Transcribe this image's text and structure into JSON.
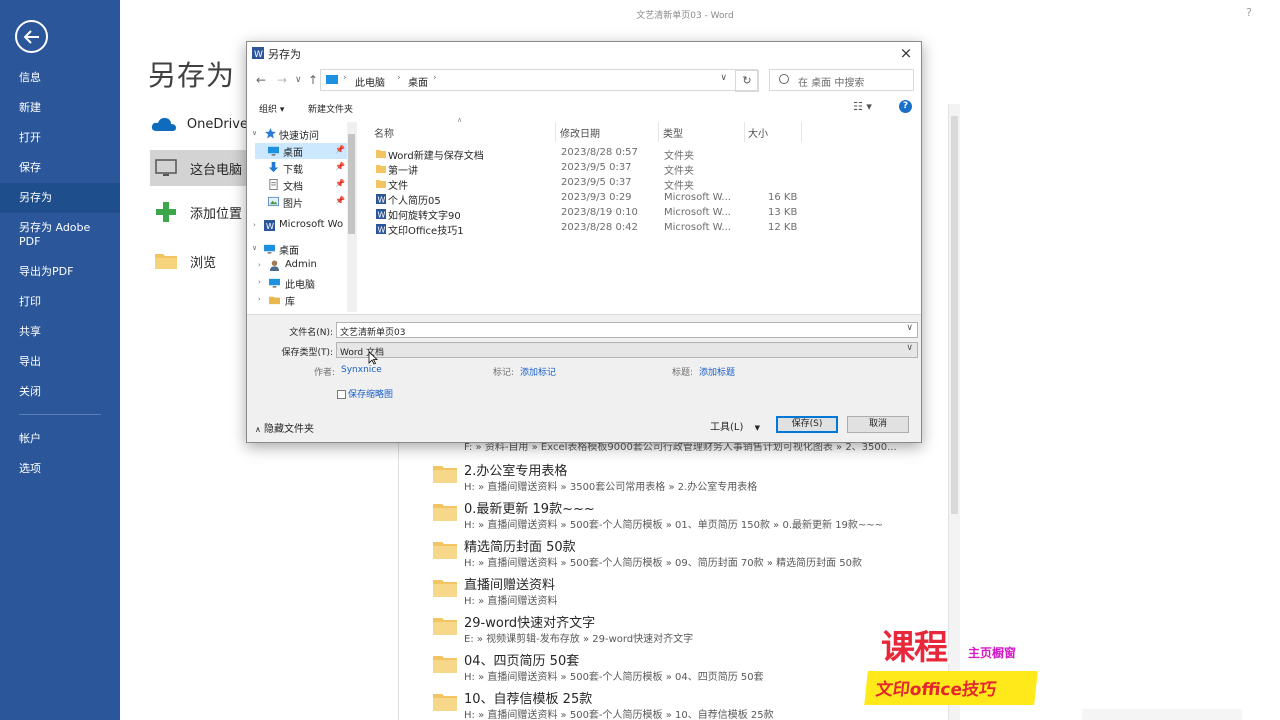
{
  "window": {
    "doc_title": "文艺清新单页03 - Word",
    "help": "?"
  },
  "nav": {
    "items": [
      {
        "label": "信息"
      },
      {
        "label": "新建"
      },
      {
        "label": "打开"
      },
      {
        "label": "保存"
      },
      {
        "label": "另存为",
        "active": true
      },
      {
        "label": "另存为 Adobe PDF"
      },
      {
        "label": "导出为PDF"
      },
      {
        "label": "打印"
      },
      {
        "label": "共享"
      },
      {
        "label": "导出"
      },
      {
        "label": "关闭"
      },
      {
        "label": "帐户"
      },
      {
        "label": "选项"
      }
    ]
  },
  "backstage": {
    "title": "另存为",
    "places": [
      {
        "label": "OneDrive",
        "icon": "cloud-icon"
      },
      {
        "label": "这台电脑",
        "icon": "computer-icon",
        "active": true
      },
      {
        "label": "添加位置",
        "icon": "plus-icon"
      },
      {
        "label": "浏览",
        "icon": "folder-icon"
      }
    ],
    "recent_partial_path": "F: » 资料-自用 » Excel表格模板9000套公司行政管理财务人事销售计划可视化图表 » 2、3500...",
    "recent": [
      {
        "name": "2.办公室专用表格",
        "path": "H: » 直播间赠送资料 » 3500套公司常用表格 » 2.办公室专用表格"
      },
      {
        "name": "0.最新更新 19款~~~",
        "path": "H: » 直播间赠送资料 » 500套-个人简历模板 » 01、单页简历 150款 » 0.最新更新 19款~~~"
      },
      {
        "name": "精选简历封面 50款",
        "path": "H: » 直播间赠送资料 » 500套-个人简历模板 » 09、简历封面 70款 » 精选简历封面 50款"
      },
      {
        "name": "直播间赠送资料",
        "path": "H: » 直播间赠送资料"
      },
      {
        "name": "29-word快速对齐文字",
        "path": "E: » 视频课剪辑-发布存放 » 29-word快速对齐文字"
      },
      {
        "name": "04、四页简历 50套",
        "path": "H: » 直播间赠送资料 » 500套-个人简历模板 » 04、四页简历 50套"
      },
      {
        "name": "10、自荐信模板 25款",
        "path": "H: » 直播间赠送资料 » 500套-个人简历模板 » 10、自荐信模板 25款"
      }
    ]
  },
  "dialog": {
    "title": "另存为",
    "close": "×",
    "address": {
      "segments": [
        "此电脑",
        "桌面"
      ]
    },
    "search_placeholder": "在 桌面 中搜索",
    "toolbar": {
      "organize": "组织 ▾",
      "new_folder": "新建文件夹",
      "view": "☷ ▾",
      "help": "?"
    },
    "tree": [
      {
        "label": "快速访问",
        "icon": "star-icon",
        "level": 0,
        "expanded": true
      },
      {
        "label": "桌面",
        "icon": "desktop-icon",
        "level": 1,
        "selected": true,
        "pinned": true
      },
      {
        "label": "下载",
        "icon": "download-icon",
        "level": 1,
        "pinned": true
      },
      {
        "label": "文档",
        "icon": "document-icon",
        "level": 1,
        "pinned": true
      },
      {
        "label": "图片",
        "icon": "picture-icon",
        "level": 1,
        "pinned": true
      },
      {
        "label": "Microsoft Wo",
        "icon": "word-icon",
        "level": 0,
        "collapsed": true
      },
      {
        "label": "桌面",
        "icon": "desktop-icon",
        "level": 0,
        "expanded": true
      },
      {
        "label": "Admin",
        "icon": "user-icon",
        "level": 1,
        "collapsed": true
      },
      {
        "label": "此电脑",
        "icon": "computer-icon",
        "level": 1,
        "collapsed": true
      },
      {
        "label": "库",
        "icon": "library-icon",
        "level": 1,
        "collapsed": true
      }
    ],
    "columns": {
      "name": "名称",
      "date": "修改日期",
      "type": "类型",
      "size": "大小"
    },
    "files": [
      {
        "name": "Word新建与保存文档",
        "date": "2023/8/28 0:57",
        "type": "文件夹",
        "size": "",
        "kind": "folder"
      },
      {
        "name": "第一讲",
        "date": "2023/9/5 0:37",
        "type": "文件夹",
        "size": "",
        "kind": "folder"
      },
      {
        "name": "文件",
        "date": "2023/9/5 0:37",
        "type": "文件夹",
        "size": "",
        "kind": "folder"
      },
      {
        "name": "个人简历05",
        "date": "2023/9/3 0:29",
        "type": "Microsoft W...",
        "size": "16 KB",
        "kind": "word"
      },
      {
        "name": "如何旋转文字90",
        "date": "2023/8/19 0:10",
        "type": "Microsoft W...",
        "size": "13 KB",
        "kind": "word"
      },
      {
        "name": "文印Office技巧1",
        "date": "2023/8/28 0:42",
        "type": "Microsoft W...",
        "size": "12 KB",
        "kind": "word"
      }
    ],
    "filename_label": "文件名(N):",
    "filename_value": "文艺清新单页03",
    "filetype_label": "保存类型(T):",
    "filetype_value": "Word 文档",
    "author_label": "作者:",
    "author_value": "Synxnice",
    "tags_label": "标记:",
    "tags_value": "添加标记",
    "title_label": "标题:",
    "title_value": "添加标题",
    "thumbnail_label": "保存缩略图",
    "hide_folders": "隐藏文件夹",
    "tools": "工具(L)",
    "save": "保存(S)",
    "cancel": "取消"
  },
  "promo": {
    "line1": "课程",
    "line1_small": "主页橱窗",
    "line2": "文印office技巧"
  },
  "colors": {
    "nav": "#2b579a",
    "accent": "#0078d7",
    "link": "#1a5fc9",
    "promo_red": "#e8283a",
    "promo_yellow": "#ffe91a"
  }
}
